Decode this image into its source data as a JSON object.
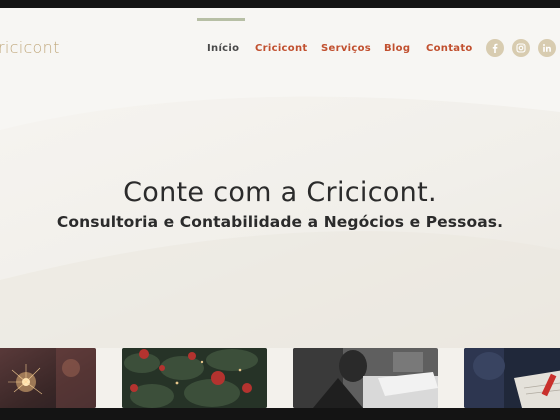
{
  "brand": {
    "logo_text": "ricicont"
  },
  "nav": {
    "items": [
      {
        "label": "Início"
      },
      {
        "label": "Cricicont"
      },
      {
        "label": "Serviços"
      },
      {
        "label": "Blog"
      },
      {
        "label": "Contato"
      }
    ]
  },
  "social": [
    "facebook-icon",
    "instagram-icon",
    "linkedin-icon"
  ],
  "hero": {
    "headline": "Conte com a Cricicont.",
    "subheadline": "Consultoria e Contabilidade a Negócios e Pessoas."
  },
  "colors": {
    "accent": "#c1502f",
    "brand": "#c2aa7f",
    "social_bg": "#d8ccb0"
  }
}
